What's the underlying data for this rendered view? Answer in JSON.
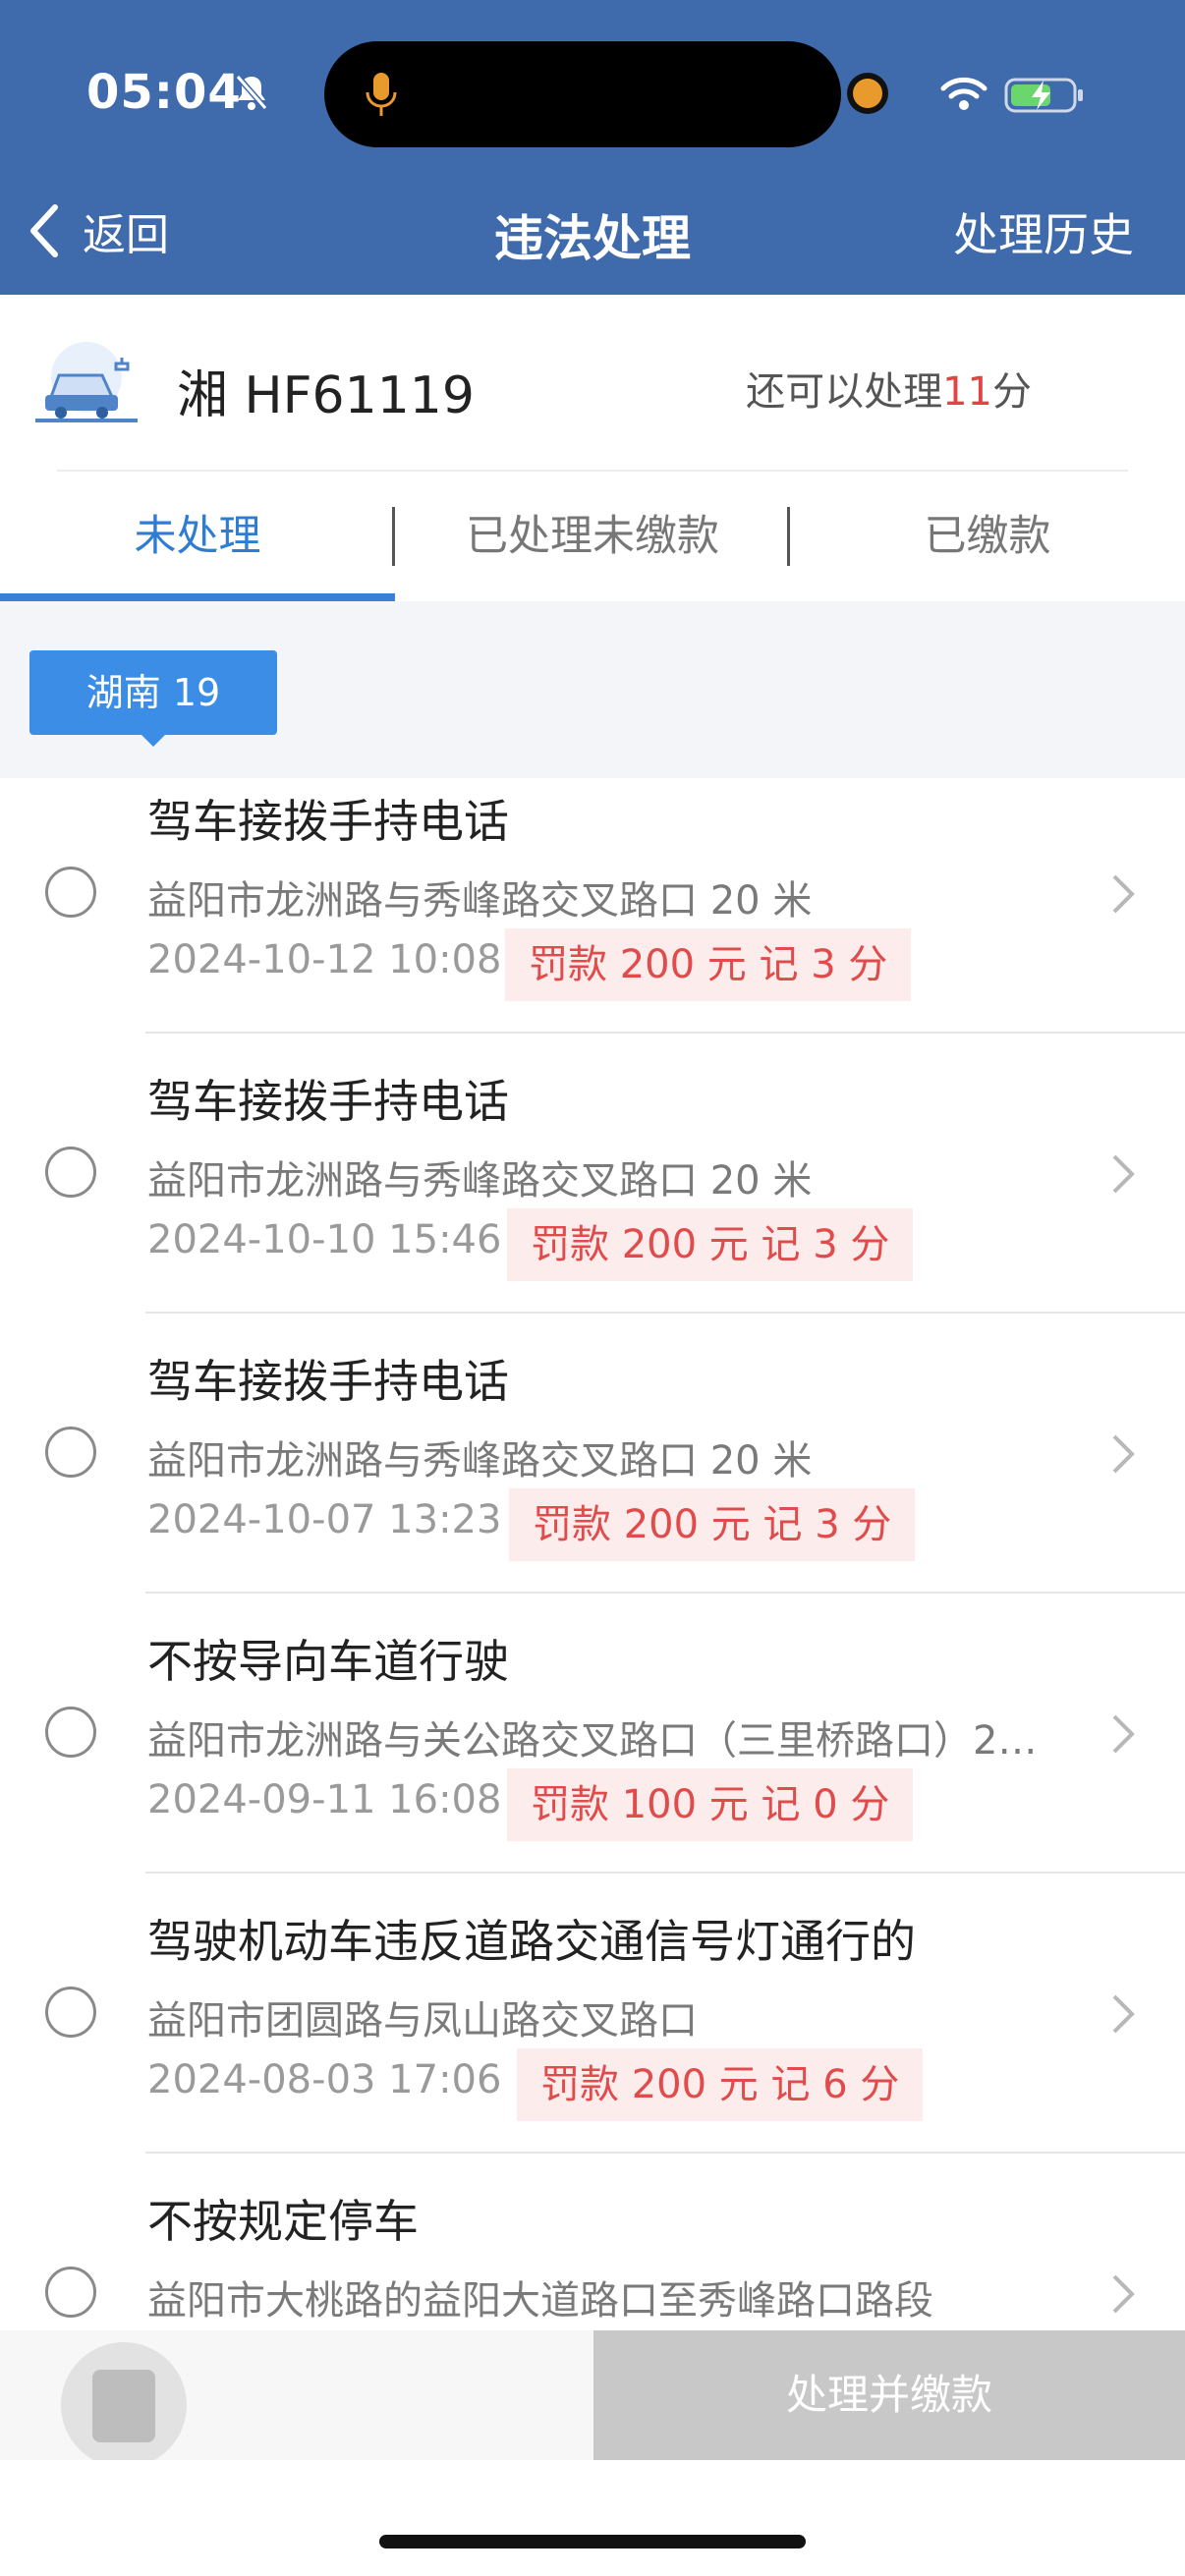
{
  "status_bar": {
    "time": "05:04"
  },
  "nav": {
    "back_label": "返回",
    "title": "违法处理",
    "history_label": "处理历史"
  },
  "vehicle": {
    "plate": "湘 HF61119",
    "remaining_prefix": "还可以处理",
    "remaining_points": "11",
    "remaining_suffix": "分"
  },
  "tabs": [
    {
      "label": "未处理",
      "active": true
    },
    {
      "label": "已处理未缴款",
      "active": false
    },
    {
      "label": "已缴款",
      "active": false
    }
  ],
  "province_chip": "湖南 19",
  "violations": [
    {
      "title": "驾车接拨手持电话",
      "address": "益阳市龙洲路与秀峰路交叉路口 20 米",
      "datetime": "2024-10-12 10:08",
      "fine": "罚款 200 元  记 3 分"
    },
    {
      "title": "驾车接拨手持电话",
      "address": "益阳市龙洲路与秀峰路交叉路口 20 米",
      "datetime": "2024-10-10 15:46",
      "fine": "罚款 200 元  记 3 分"
    },
    {
      "title": "驾车接拨手持电话",
      "address": "益阳市龙洲路与秀峰路交叉路口 20 米",
      "datetime": "2024-10-07 13:23",
      "fine": "罚款 200 元  记 3 分"
    },
    {
      "title": "不按导向车道行驶",
      "address": "益阳市龙洲路与关公路交叉路口（三里桥路口）2…",
      "datetime": "2024-09-11 16:08",
      "fine": "罚款 100 元  记 0 分"
    },
    {
      "title": "驾驶机动车违反道路交通信号灯通行的",
      "address": "益阳市团圆路与凤山路交叉路口",
      "datetime": "2024-08-03 17:06",
      "fine": "罚款 200 元  记 6 分"
    },
    {
      "title": "不按规定停车",
      "address": "益阳市大桃路的益阳大道路口至秀峰路口路段",
      "datetime": "",
      "fine": ""
    }
  ],
  "bottom": {
    "pay_label": "处理并缴款"
  },
  "colors": {
    "header": "#3f6aab",
    "accent": "#3a80d8",
    "fine_text": "#e04b4b",
    "fine_bg": "#fdecec",
    "disabled_button": "#c8c8c8"
  }
}
